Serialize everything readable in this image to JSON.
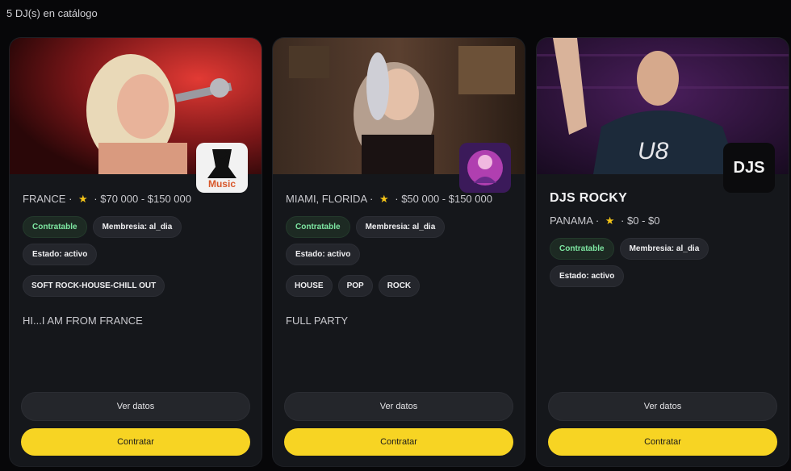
{
  "header": {
    "count_text": "5 DJ(s) en catálogo"
  },
  "cards": [
    {
      "name": "",
      "location": "FRANCE",
      "price": "$70 000 - $150 000",
      "chips": [
        "Contratable",
        "Membresia: al_dia",
        "Estado: activo"
      ],
      "tags": [
        "SOFT ROCK-HOUSE-CHILL OUT"
      ],
      "bio": "HI...I AM FROM FRANCE",
      "logo_text": "Music",
      "view_label": "Ver datos",
      "hire_label": "Contratar"
    },
    {
      "name": "",
      "location": "MIAMI, FLORIDA",
      "price": "$50 000 - $150 000",
      "chips": [
        "Contratable",
        "Membresia: al_dia",
        "Estado: activo"
      ],
      "tags": [
        "HOUSE",
        "POP",
        "ROCK"
      ],
      "bio": "FULL PARTY",
      "logo_text": "",
      "view_label": "Ver datos",
      "hire_label": "Contratar"
    },
    {
      "name": "DJS ROCKY",
      "location": "PANAMA",
      "price": "$0 - $0",
      "chips": [
        "Contratable",
        "Membresia: al_dia",
        "Estado: activo"
      ],
      "tags": [],
      "bio": "",
      "logo_text": "DJS",
      "view_label": "Ver datos",
      "hire_label": "Contratar"
    }
  ],
  "colors": {
    "accent": "#f7d423",
    "card_bg": "#15171b",
    "chip_green": "#7ee7a2"
  },
  "icons": {
    "rating": "star-icon"
  }
}
